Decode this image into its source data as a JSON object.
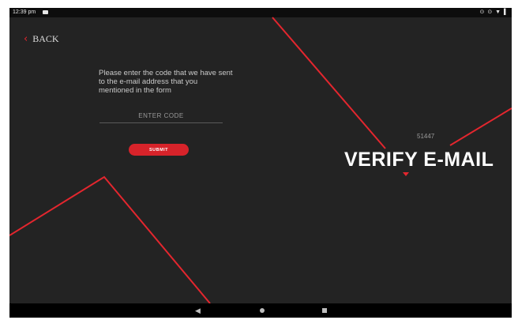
{
  "status_bar": {
    "time": "12:39 pm",
    "icons": "⊙ ⊙ ▼ ▌"
  },
  "header": {
    "back_label": "BACK"
  },
  "form": {
    "prompt": "Please enter the code that we have sent to the e-mail address that you mentioned in the form",
    "code_placeholder": "ENTER CODE",
    "submit_label": "SUBMIT"
  },
  "hero": {
    "code_hint": "51447",
    "title": "VERIFY E-MAIL"
  },
  "nav_bar": {
    "back_glyph": "◀"
  },
  "theme": {
    "background": "#232323",
    "accent": "#e3262e",
    "text": "#ffffff"
  }
}
